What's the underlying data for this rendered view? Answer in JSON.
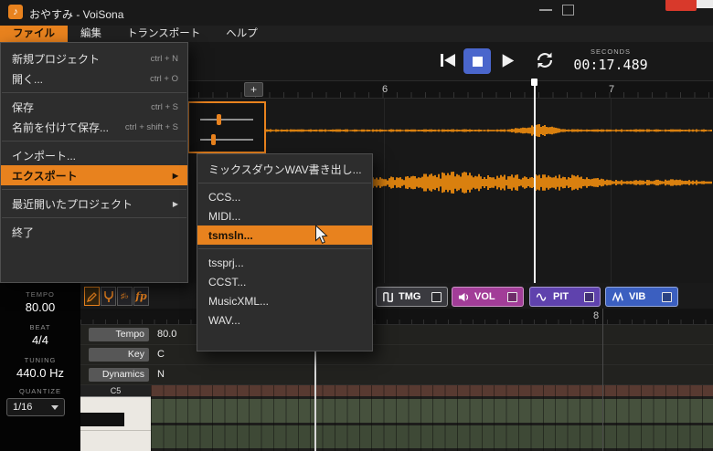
{
  "colors": {
    "accent": "#e8821e",
    "stop_button": "#4a66cc",
    "waveform": "#d9800f",
    "vol": "#a23d98",
    "pit": "#5f42ad",
    "vib": "#3b5fc0",
    "tmg": "#3a3a3f"
  },
  "window": {
    "title": "おやすみ - VoiSona"
  },
  "menu_bar": {
    "items": [
      {
        "label": "ファイル"
      },
      {
        "label": "編集"
      },
      {
        "label": "トランスポート"
      },
      {
        "label": "ヘルプ"
      }
    ]
  },
  "file_menu": {
    "items": [
      {
        "label": "新規プロジェクト",
        "shortcut": "ctrl + N"
      },
      {
        "label": "開く...",
        "shortcut": "ctrl + O"
      },
      {
        "label": "保存",
        "shortcut": "ctrl + S"
      },
      {
        "label": "名前を付けて保存...",
        "shortcut": "ctrl + shift + S"
      },
      {
        "label": "インポート..."
      },
      {
        "label": "エクスポート"
      },
      {
        "label": "最近開いたプロジェクト"
      },
      {
        "label": "終了"
      }
    ]
  },
  "export_submenu": {
    "items": [
      {
        "label": "ミックスダウンWAV書き出し..."
      },
      {
        "label": "CCS..."
      },
      {
        "label": "MIDI..."
      },
      {
        "label": "tsmsln..."
      },
      {
        "label": "tssprj..."
      },
      {
        "label": "CCST..."
      },
      {
        "label": "MusicXML..."
      },
      {
        "label": "WAV..."
      }
    ]
  },
  "transport": {
    "seconds_label": "SECONDS",
    "time": "00:17.489"
  },
  "ruler": {
    "plus_button": "+",
    "markers": [
      "6",
      "7"
    ]
  },
  "bottom_ruler": {
    "marker": "8"
  },
  "left_panel": {
    "tempo_label": "TEMPO",
    "tempo_value": "80.00",
    "beat_label": "BEAT",
    "beat_value": "4/4",
    "tuning_label": "TUNING",
    "tuning_value": "440.0 Hz",
    "quantize_label": "QUANTIZE",
    "quantize_value": "1/16"
  },
  "track_properties": {
    "rows": [
      {
        "label": "Tempo",
        "value": "80.0"
      },
      {
        "label": "Key",
        "value": "C"
      },
      {
        "label": "Dynamics",
        "value": "N"
      }
    ]
  },
  "parameter_lanes": {
    "items": [
      {
        "label": "TMG"
      },
      {
        "label": "VOL"
      },
      {
        "label": "PIT"
      },
      {
        "label": "VIB"
      }
    ]
  },
  "piano_roll": {
    "octave_label": "C5"
  }
}
